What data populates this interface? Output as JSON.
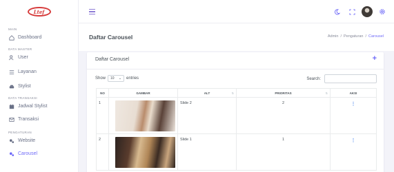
{
  "brand": {
    "logo_text": "Ltef"
  },
  "sidebar": {
    "sections": [
      {
        "label": "MAIN",
        "items": [
          {
            "label": "Dashboard",
            "icon": "home-icon",
            "active": false
          }
        ]
      },
      {
        "label": "DATA MASTER",
        "items": [
          {
            "label": "User",
            "icon": "users-icon",
            "active": false
          },
          {
            "label": "Layanan",
            "icon": "list-icon",
            "active": false
          },
          {
            "label": "Stylist",
            "icon": "car-icon",
            "active": false
          }
        ]
      },
      {
        "label": "DATA TRANSAKSI",
        "items": [
          {
            "label": "Jadwal Stylist",
            "icon": "calendar-icon",
            "active": false
          },
          {
            "label": "Transaksi",
            "icon": "mail-icon",
            "active": false
          }
        ]
      },
      {
        "label": "PENGATURAN",
        "items": [
          {
            "label": "Website",
            "icon": "cogs-icon",
            "active": false
          },
          {
            "label": "Carousel",
            "icon": "cogs-icon",
            "active": true
          }
        ]
      }
    ]
  },
  "page": {
    "title": "Daftar Carousel",
    "breadcrumb": [
      "Admin",
      "/",
      "Pengaturan",
      "/",
      "Carousel"
    ]
  },
  "card": {
    "title": "Daftar Carousel",
    "add_label": "+",
    "show_label": "Show",
    "entries_value": "10",
    "entries_label": "entries",
    "search_label": "Search:",
    "search_value": ""
  },
  "table": {
    "headers": [
      "NO",
      "GAMBAR",
      "ALT",
      "PRIORITAS",
      "AKSI"
    ],
    "rows": [
      {
        "no": "1",
        "alt": "Slide 2",
        "prioritas": "2",
        "aksi": "⋮"
      },
      {
        "no": "2",
        "alt": "Slide 1",
        "prioritas": "1",
        "aksi": "⋮"
      }
    ]
  },
  "colors": {
    "accent": "#6f6af8",
    "brand_red": "#d63b3b",
    "bg": "#f3f3f9"
  }
}
